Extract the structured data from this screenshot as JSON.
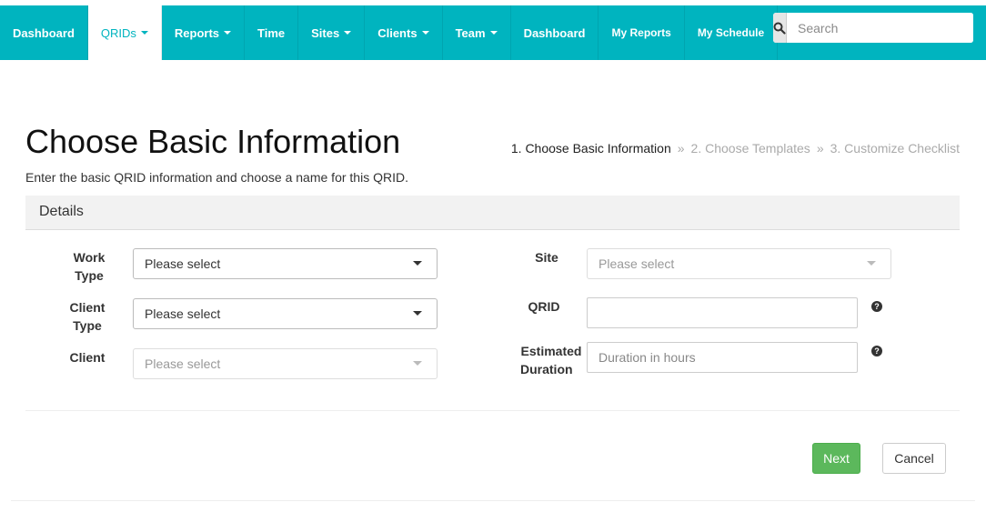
{
  "nav": {
    "items": [
      {
        "label": "Dashboard",
        "caret": false
      },
      {
        "label": "QRIDs",
        "caret": true
      },
      {
        "label": "Reports",
        "caret": true
      },
      {
        "label": "Time",
        "caret": false
      },
      {
        "label": "Sites",
        "caret": true
      },
      {
        "label": "Clients",
        "caret": true
      },
      {
        "label": "Team",
        "caret": true
      },
      {
        "label": "Dashboard",
        "caret": false
      },
      {
        "label": "My Reports",
        "caret": false
      },
      {
        "label": "My Schedule",
        "caret": false
      }
    ],
    "active_label": "QRIDs",
    "search_placeholder": "Search",
    "search_icon": "search-icon"
  },
  "header": {
    "title": "Choose Basic Information",
    "subtitle": "Enter the basic QRID information and choose a name for this QRID.",
    "steps": [
      "1. Choose Basic Information",
      "2. Choose Templates",
      "3. Customize Checklist"
    ],
    "separator": "»"
  },
  "panel": {
    "title": "Details",
    "work_type": {
      "label_line1": "Work",
      "label_line2": "Type",
      "value": "Please select"
    },
    "client_type": {
      "label_line1": "Client",
      "label_line2": "Type",
      "value": "Please select"
    },
    "client": {
      "label": "Client",
      "value": "Please select"
    },
    "site": {
      "label": "Site",
      "value": "Please select"
    },
    "qrid": {
      "label": "QRID",
      "value": ""
    },
    "duration": {
      "label_line1": "Estimated",
      "label_line2": "Duration",
      "placeholder": "Duration in hours"
    },
    "help_glyph": "?"
  },
  "actions": {
    "next": "Next",
    "cancel": "Cancel"
  },
  "colors": {
    "navbar": "#00b4bf",
    "next_button": "#5cb85c",
    "panel_header": "#f2f2f2"
  }
}
